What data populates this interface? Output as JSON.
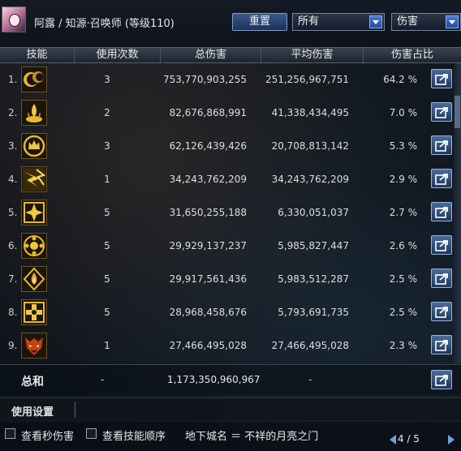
{
  "header": {
    "character_title": "阿露 / 知源·召唤师 (等级110)",
    "reset_label": "重置",
    "filter_select": "所有",
    "type_select": "伤害"
  },
  "table": {
    "columns": [
      "技能",
      "使用次数",
      "总伤害",
      "平均伤害",
      "伤害占比"
    ],
    "rows": [
      {
        "index": "1.",
        "icon": "dark-orb-skill-icon",
        "uses": "3",
        "total": "753,770,903,255",
        "avg": "251,256,967,751",
        "pct": "64.2 %"
      },
      {
        "index": "2.",
        "icon": "golden-flame-skill-icon",
        "uses": "2",
        "total": "82,676,868,991",
        "avg": "41,338,434,495",
        "pct": "7.0 %"
      },
      {
        "index": "3.",
        "icon": "crown-circle-skill-icon",
        "uses": "3",
        "total": "62,126,439,426",
        "avg": "20,708,813,142",
        "pct": "5.3 %"
      },
      {
        "index": "4.",
        "icon": "lightning-burst-skill-icon",
        "uses": "1",
        "total": "34,243,762,209",
        "avg": "34,243,762,209",
        "pct": "2.9 %"
      },
      {
        "index": "5.",
        "icon": "star-sigil-skill-icon",
        "uses": "5",
        "total": "31,650,255,188",
        "avg": "6,330,051,037",
        "pct": "2.7 %"
      },
      {
        "index": "6.",
        "icon": "rune-circle-skill-icon",
        "uses": "5",
        "total": "29,929,137,237",
        "avg": "5,985,827,447",
        "pct": "2.6 %"
      },
      {
        "index": "7.",
        "icon": "flame-sigil-skill-icon",
        "uses": "5",
        "total": "29,917,561,436",
        "avg": "5,983,512,287",
        "pct": "2.5 %"
      },
      {
        "index": "8.",
        "icon": "cross-sigil-skill-icon",
        "uses": "5",
        "total": "28,968,458,676",
        "avg": "5,793,691,735",
        "pct": "2.5 %"
      },
      {
        "index": "9.",
        "icon": "demon-face-skill-icon",
        "uses": "1",
        "total": "27,466,495,028",
        "avg": "27,466,495,028",
        "pct": "2.3 %"
      }
    ]
  },
  "summary": {
    "label": "总和",
    "uses": "-",
    "total": "1,173,350,960,967",
    "avg": "-"
  },
  "settings": {
    "title": "使用设置"
  },
  "options": {
    "per_second_label": "查看秒伤害",
    "skill_order_label": "查看技能顺序",
    "dungeon_text": "地下城名 ＝ 不祥的月亮之门",
    "page": "4 / 5"
  },
  "colors": {
    "accent_blue": "#6fa0e0",
    "icon_gold": "#e8b830",
    "icon_red": "#d04020"
  }
}
